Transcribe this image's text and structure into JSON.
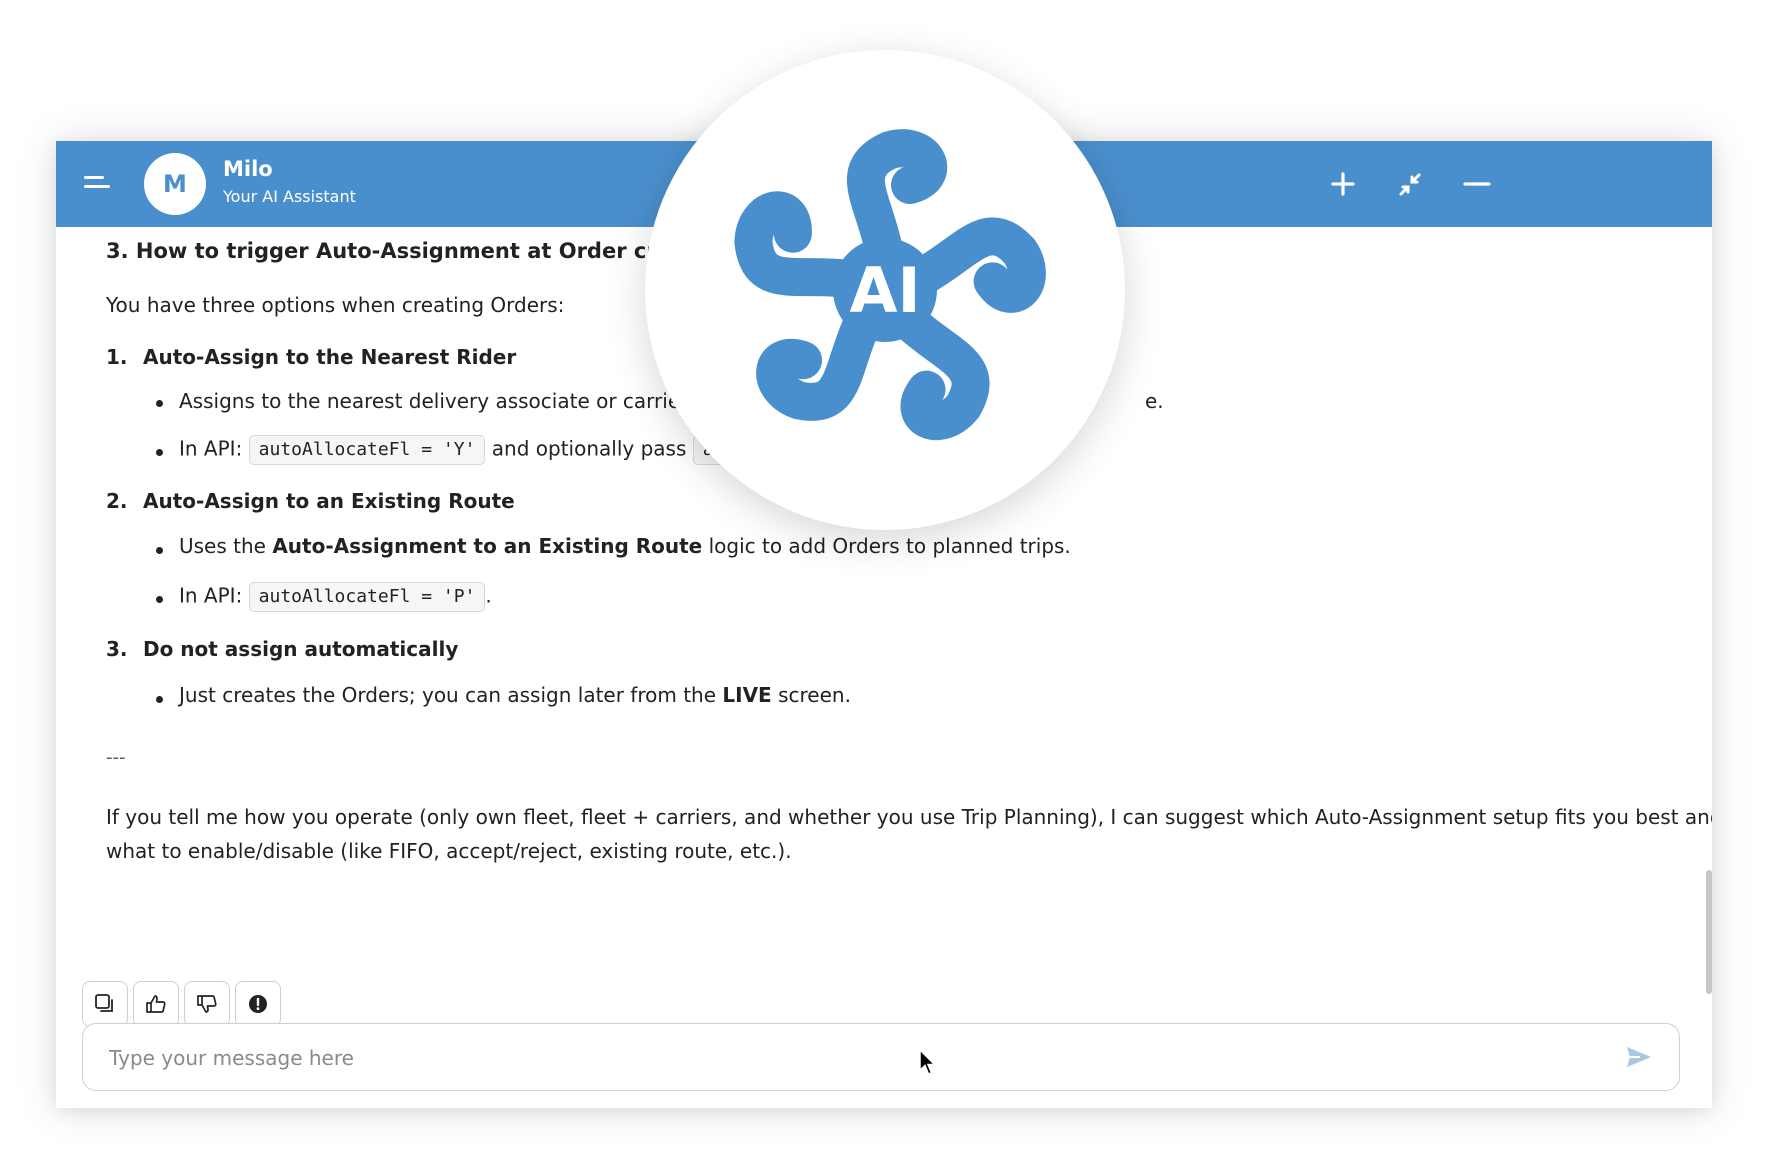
{
  "header": {
    "avatar_letter": "M",
    "name": "Milo",
    "subtitle": "Your AI Assistant",
    "icons": [
      "menu-icon",
      "plus-icon",
      "collapse-icon",
      "minimize-icon"
    ]
  },
  "logo": {
    "text": "AI",
    "color": "#4a8fcd"
  },
  "colors": {
    "brand": "#4a8fcd",
    "header_text": "#ffffff"
  },
  "message": {
    "heading": "3. How to trigger Auto-Assignment at Order creati",
    "intro": "You have three options when creating Orders:",
    "options": [
      {
        "number": "1.",
        "title": "Auto-Assign to the Nearest Rider",
        "bullet1": "Assigns to the nearest delivery associate or carrier b",
        "bullet1_tail": "e.",
        "bullet2_prefix": "In API:",
        "bullet2_code": "autoAllocateFl = 'Y'",
        "bullet2_mid": "and optionally pass",
        "bullet2_code2": "au"
      },
      {
        "number": "2.",
        "title": "Auto-Assign to an Existing Route",
        "bullet1_pre": "Uses the",
        "bullet1_bold": "Auto-Assignment to an Existing Route",
        "bullet1_post": "logic to add Orders to planned trips.",
        "bullet2_prefix": "In API:",
        "bullet2_code": "autoAllocateFl = 'P'",
        "bullet2_suffix": "."
      },
      {
        "number": "3.",
        "title": "Do not assign automatically",
        "bullet1_pre": "Just creates the Orders; you can assign later from the",
        "bullet1_bold": "LIVE",
        "bullet1_post": "screen."
      }
    ],
    "separator": "---",
    "closing_line1": "If you tell me how you operate (only own fleet, fleet + carriers, and whether you use Trip Planning), I can suggest which Auto-Assignment setup fits you best and",
    "closing_line2": "what to enable/disable (like FIFO, accept/reject, existing route, etc.)."
  },
  "actions": [
    "copy-icon",
    "thumbs-up-icon",
    "thumbs-down-icon",
    "report-icon"
  ],
  "input": {
    "placeholder": "Type your message here",
    "value": ""
  }
}
